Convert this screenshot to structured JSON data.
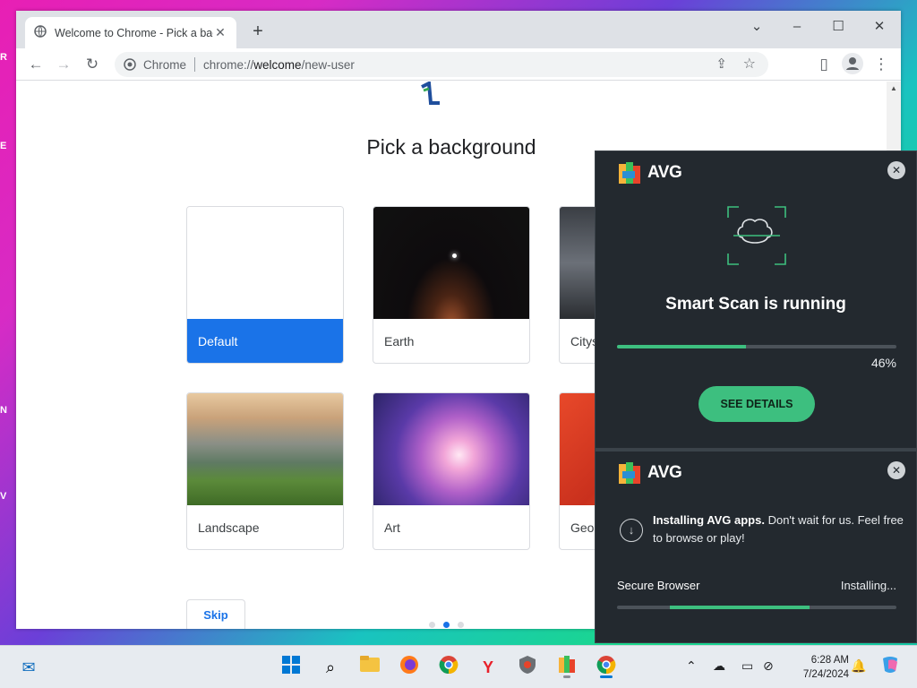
{
  "browser": {
    "tab_title": "Welcome to Chrome - Pick a bac",
    "omnibox_chip": "Chrome",
    "url_scheme": "chrome://",
    "url_host": "welcome",
    "url_path": "/new-user"
  },
  "page": {
    "heading": "Pick a background",
    "cards": [
      {
        "label": "Default",
        "selected": true
      },
      {
        "label": "Earth"
      },
      {
        "label": "Citys"
      },
      {
        "label": "Landscape"
      },
      {
        "label": "Art"
      },
      {
        "label": "Geo"
      }
    ],
    "skip_label": "Skip",
    "pagination": {
      "total": 3,
      "current": 2
    }
  },
  "avg_scan": {
    "brand": "AVG",
    "title": "Smart Scan is running",
    "progress": 0.46,
    "progress_label": "46%",
    "button_label": "SEE DETAILS"
  },
  "avg_install": {
    "brand": "AVG",
    "message_bold": "Installing AVG apps.",
    "message_rest": " Don't wait for us. Feel free to browse or play!",
    "item_label": "Secure Browser",
    "item_status": "Installing...",
    "item_progress_start": 0.19,
    "item_progress_end": 0.69
  },
  "taskbar": {
    "time": "6:28 AM",
    "date": "7/24/2024",
    "accent": "#0078d4"
  }
}
